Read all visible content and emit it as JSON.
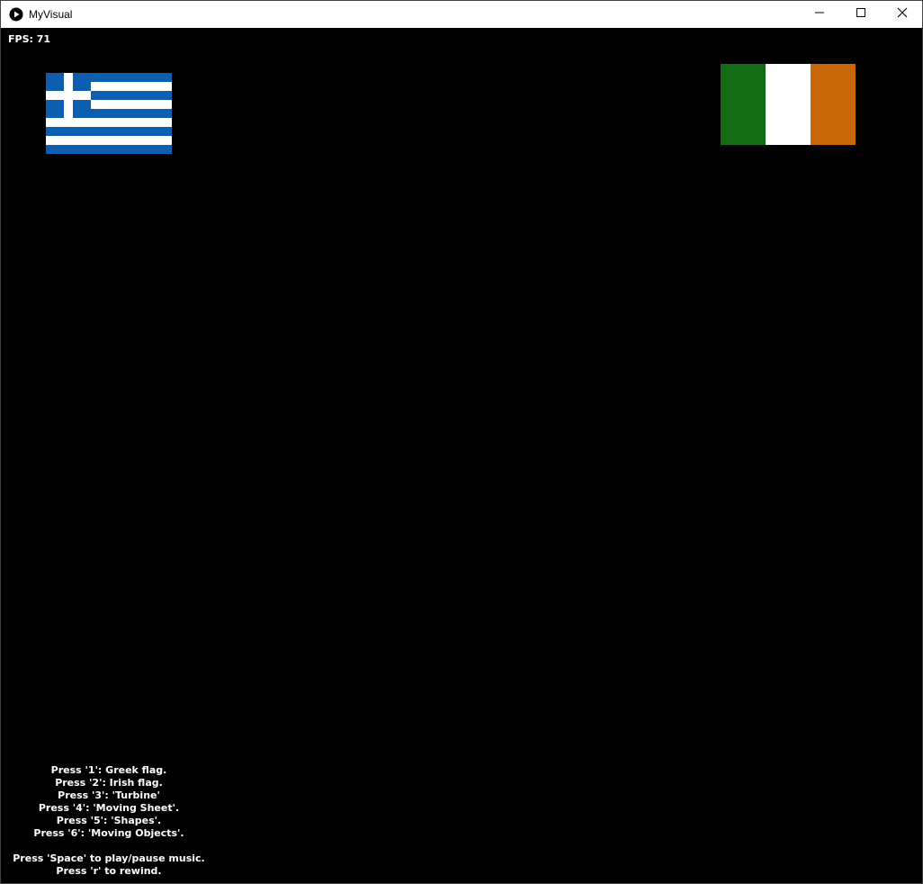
{
  "window": {
    "title": "MyVisual",
    "icon": "play-circle-icon",
    "controls": [
      "minimize-icon",
      "maximize-icon",
      "close-icon"
    ]
  },
  "canvas": {
    "fps_text": "FPS: 71",
    "flags": [
      {
        "name": "greek",
        "colors": {
          "blue": "#0D5EAF",
          "white": "#FFFFFF"
        }
      },
      {
        "name": "irish",
        "colors": {
          "green": "#136B14",
          "white": "#FFFFFF",
          "orange": "#C8660A"
        }
      }
    ],
    "instructions": {
      "lines": [
        "Press '1': Greek flag.",
        "Press '2': Irish flag.",
        "Press '3': 'Turbine'",
        "Press '4': 'Moving Sheet'.",
        "Press '5': 'Shapes'.",
        "Press '6': 'Moving Objects'."
      ],
      "music_lines": [
        "Press 'Space' to play/pause music.",
        "Press 'r' to rewind."
      ]
    }
  }
}
